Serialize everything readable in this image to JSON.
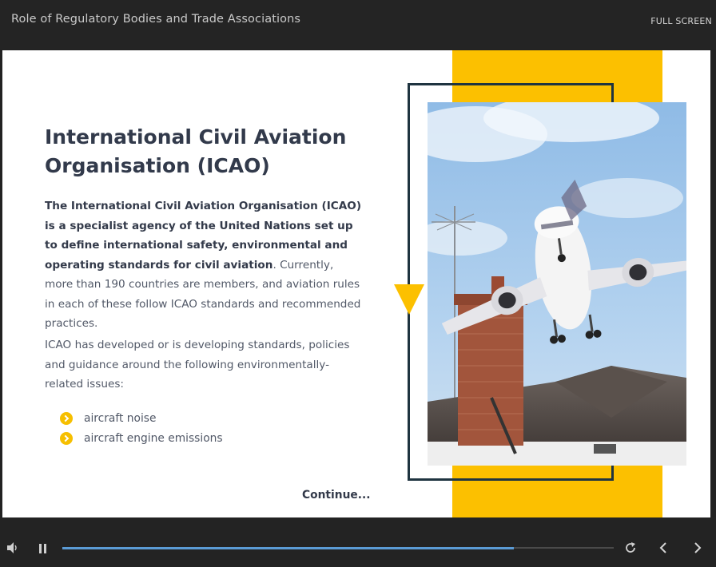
{
  "header": {
    "course_title": "Role of Regulatory Bodies and Trade Associations",
    "fullscreen_label": "FULL SCREEN"
  },
  "slide": {
    "title": "International Civil Aviation Organisation (ICAO)",
    "para1_bold": "The International Civil Aviation Organisation (ICAO) is a specialist agency of the United Nations set up to define international safety, environmental and operating standards for civil aviation",
    "para1_rest": ". Currently, more than 190 countries are members, and aviation rules in each of these follow ICAO standards and recommended practices.",
    "para2": "ICAO has developed or is developing standards, policies and guidance around the following environmentally-related issues:",
    "bullets": [
      "aircraft noise",
      "aircraft engine emissions"
    ],
    "continue_label": "Continue..."
  },
  "player": {
    "progress_fraction": 0.819
  },
  "colors": {
    "accent_yellow": "#fcc000",
    "frame_navy": "#1f3440",
    "progress_blue": "#5b9bd5"
  },
  "icons": {
    "volume": "volume-icon",
    "pause": "pause-icon",
    "replay": "replay-icon",
    "prev": "chevron-left-icon",
    "next": "chevron-right-icon",
    "bullet": "chevron-circle-icon"
  }
}
